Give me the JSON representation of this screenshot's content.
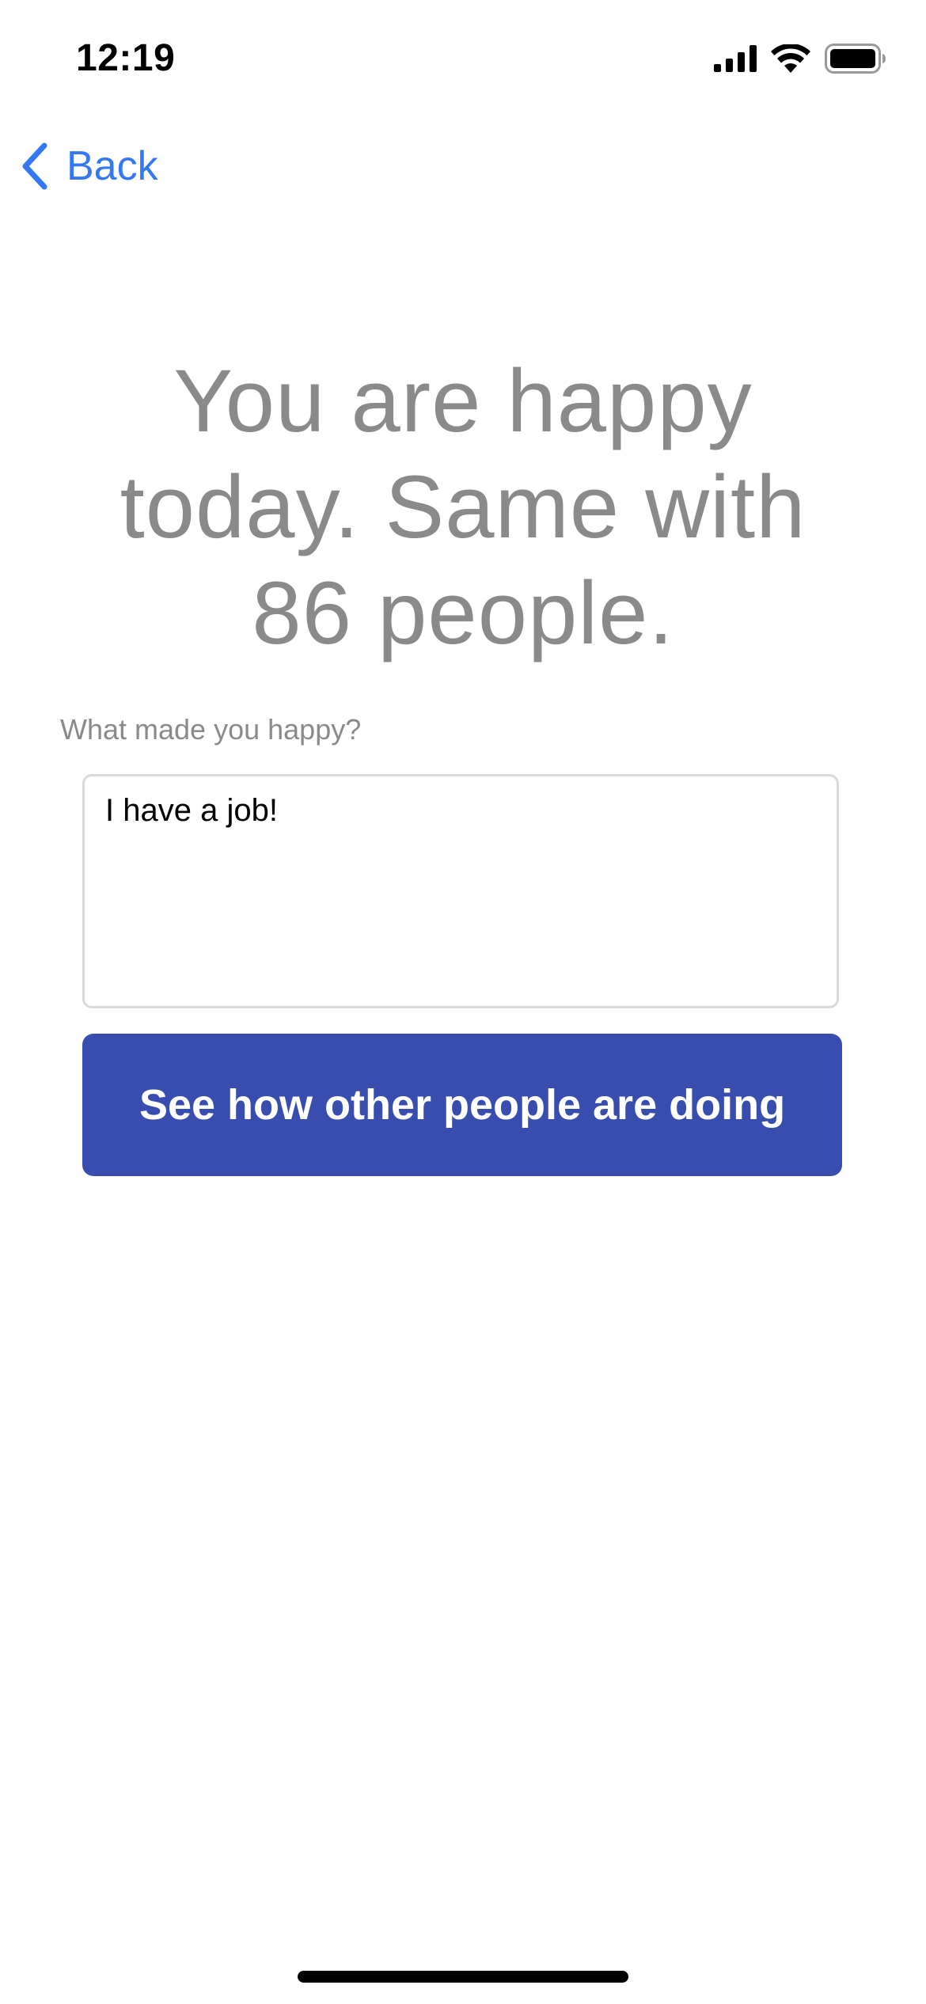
{
  "status_bar": {
    "time": "12:19",
    "icons": [
      "cellular-signal-icon",
      "wifi-icon",
      "battery-icon"
    ]
  },
  "nav": {
    "back_label": "Back",
    "back_icon": "chevron-left-icon",
    "accent_color": "#3478f6"
  },
  "headline": {
    "text": "You are happy today. Same with 86 people."
  },
  "prompt": {
    "label": "What made you happy?"
  },
  "answer_field": {
    "value": "I have a job!"
  },
  "primary_action": {
    "label": "See how other people are doing",
    "color": "#384dae"
  }
}
